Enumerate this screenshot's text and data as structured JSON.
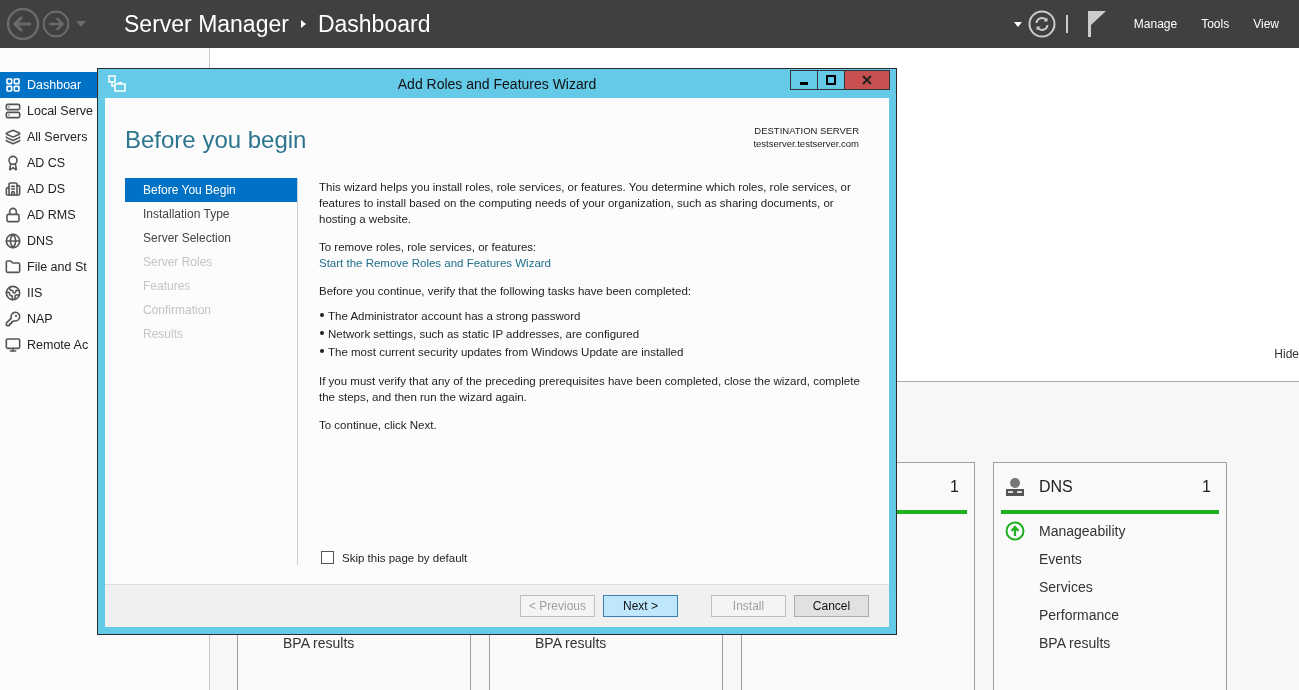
{
  "app": {
    "breadcrumb": [
      "Server Manager",
      "Dashboard"
    ],
    "menu": [
      "Manage",
      "Tools",
      "View"
    ]
  },
  "sidebar": {
    "items": [
      {
        "label": "Dashboar",
        "selected": true
      },
      {
        "label": "Local Serve",
        "selected": false
      },
      {
        "label": "All Servers",
        "selected": false
      },
      {
        "label": "AD CS",
        "selected": false
      },
      {
        "label": "AD DS",
        "selected": false
      },
      {
        "label": "AD RMS",
        "selected": false
      },
      {
        "label": "DNS",
        "selected": false
      },
      {
        "label": "File and St",
        "selected": false
      },
      {
        "label": "IIS",
        "selected": false
      },
      {
        "label": "NAP",
        "selected": false
      },
      {
        "label": "Remote Ac",
        "selected": false
      }
    ]
  },
  "welcome": {
    "hide_link": "Hide"
  },
  "tiles": [
    {
      "items": [
        {
          "label": "BPA results",
          "ok": false
        }
      ]
    },
    {
      "items": [
        {
          "label": "BPA results",
          "ok": false
        }
      ]
    },
    {
      "count": "1",
      "healthy": true
    },
    {
      "title": "DNS",
      "count": "1",
      "healthy": true,
      "items": [
        {
          "label": "Manageability",
          "ok": true
        },
        {
          "label": "Events",
          "ok": false
        },
        {
          "label": "Services",
          "ok": false
        },
        {
          "label": "Performance",
          "ok": false
        },
        {
          "label": "BPA results",
          "ok": false
        }
      ]
    }
  ],
  "dialog": {
    "title": "Add Roles and Features Wizard",
    "heading": "Before you begin",
    "destination": {
      "label": "DESTINATION SERVER",
      "server": "testserver.testserver.com"
    },
    "steps": [
      {
        "label": "Before You Begin",
        "selected": true,
        "disabled": false
      },
      {
        "label": "Installation Type",
        "selected": false,
        "disabled": false
      },
      {
        "label": "Server Selection",
        "selected": false,
        "disabled": false
      },
      {
        "label": "Server Roles",
        "selected": false,
        "disabled": true
      },
      {
        "label": "Features",
        "selected": false,
        "disabled": true
      },
      {
        "label": "Confirmation",
        "selected": false,
        "disabled": true
      },
      {
        "label": "Results",
        "selected": false,
        "disabled": true
      }
    ],
    "body": [
      {
        "kind": "paragraph",
        "text": "This wizard helps you install roles, role services, or features. You determine which roles, role services, or features to install based on the computing needs of your organization, such as sharing documents, or hosting a website."
      },
      {
        "kind": "paragraph",
        "text": "To remove roles, role services, or features:",
        "link": "Start the Remove Roles and Features Wizard"
      },
      {
        "kind": "paragraph",
        "text": "Before you continue, verify that the following tasks have been completed:"
      },
      {
        "kind": "bullets",
        "items": [
          "The Administrator account has a strong password",
          "Network settings, such as static IP addresses, are configured",
          "The most current security updates from Windows Update are installed"
        ]
      },
      {
        "kind": "paragraph",
        "text": "If you must verify that any of the preceding prerequisites have been completed, close the wizard, complete the steps, and then run the wizard again."
      },
      {
        "kind": "paragraph",
        "text": "To continue, click Next."
      }
    ],
    "skip_checkbox": {
      "label": "Skip this page by default",
      "checked": false
    },
    "buttons": [
      {
        "label": "< Previous",
        "kind": "normal",
        "disabled": true
      },
      {
        "label": "Next >",
        "kind": "default",
        "disabled": false
      },
      {
        "label": "Install",
        "kind": "normal",
        "disabled": true
      },
      {
        "label": "Cancel",
        "kind": "normal",
        "disabled": false
      }
    ]
  }
}
